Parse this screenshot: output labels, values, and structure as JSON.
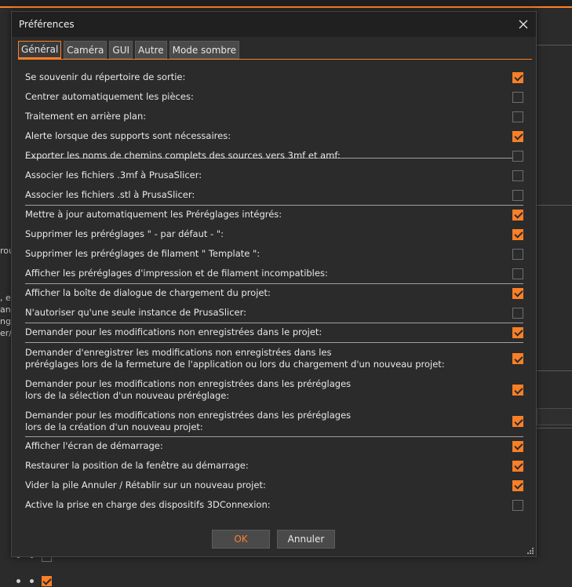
{
  "dialog": {
    "title": "Préférences",
    "close_icon": "close-icon",
    "accent_color": "#ff7f27",
    "tabs": [
      {
        "label": "Général",
        "active": true
      },
      {
        "label": "Caméra",
        "active": false
      },
      {
        "label": "GUI",
        "active": false
      },
      {
        "label": "Autre",
        "active": false
      },
      {
        "label": "Mode sombre",
        "active": false
      }
    ],
    "options": [
      {
        "label": "Se souvenir du répertoire de sortie:",
        "checked": true
      },
      {
        "label": "Centrer automatiquement les pièces:",
        "checked": false
      },
      {
        "label": "Traitement en arrière plan:",
        "checked": false
      },
      {
        "label": "Alerte lorsque des supports sont nécessaires:",
        "checked": true
      },
      {
        "label": "Exporter les noms de chemins complets des sources vers 3mf et amf:",
        "checked": false
      },
      {
        "label": "Associer les fichiers .3mf à PrusaSlicer:",
        "checked": false
      },
      {
        "label": "Associer les fichiers .stl à PrusaSlicer:",
        "checked": false
      },
      {
        "label": "Mettre à jour automatiquement les Préréglages intégrés:",
        "checked": true
      },
      {
        "label": "Supprimer les préréglages \" - par défaut - \":",
        "checked": true
      },
      {
        "label": "Supprimer les préréglages de filament \" Template \":",
        "checked": false
      },
      {
        "label": "Afficher les préréglages d'impression et de filament incompatibles:",
        "checked": false
      },
      {
        "label": "Afficher la boîte de dialogue de chargement du projet:",
        "checked": true
      },
      {
        "label": "N'autoriser qu'une seule instance de PrusaSlicer:",
        "checked": false
      },
      {
        "label": "Demander pour les modifications non enregistrées dans le projet:",
        "checked": true
      },
      {
        "label": "Demander d'enregistrer les modifications non enregistrées dans les\npréréglages lors de la fermeture de l'application ou lors du chargement d'un nouveau projet:",
        "checked": true
      },
      {
        "label": "Demander pour les modifications non enregistrées dans les préréglages\nlors de la sélection d'un nouveau préréglage:",
        "checked": true
      },
      {
        "label": "Demander pour les modifications non enregistrées dans les préréglages\nlors de la création d'un nouveau projet:",
        "checked": true
      },
      {
        "label": "Afficher l'écran de démarrage:",
        "checked": true
      },
      {
        "label": "Restaurer la position de la fenêtre au démarrage:",
        "checked": true
      },
      {
        "label": "Vider la pile Annuler / Rétablir sur un nouveau projet:",
        "checked": true
      },
      {
        "label": "Active la prise en charge des dispositifs 3DConnexion:",
        "checked": false
      }
    ],
    "ok_label": "OK",
    "cancel_label": "Annuler"
  },
  "background": {
    "left_fragments": [
      "rou",
      ", er",
      "ant",
      "ng",
      "er/"
    ]
  }
}
